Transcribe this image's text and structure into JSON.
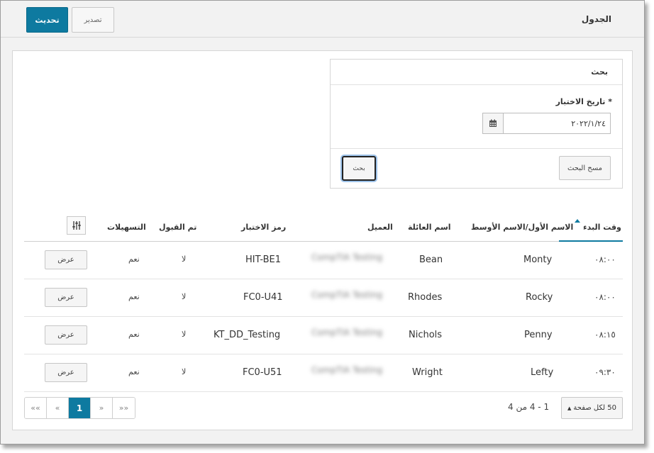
{
  "header": {
    "title": "الجدول",
    "refresh_label": "تحديث",
    "export_label": "تصدير"
  },
  "search": {
    "title": "بحث",
    "date_label": "تاريخ الاختبار *",
    "date_value": "٢٠٢٢/١/٢٤",
    "clear_label": "مسح البحث",
    "search_label": "بحث"
  },
  "table": {
    "columns": {
      "start_time": "وقت البدء",
      "first_middle": "الاسم الأول/الاسم الأوسط",
      "last_name": "اسم العائلة",
      "client": "العميل",
      "test_code": "رمز الاختبار",
      "accepted": "تم القبول",
      "accommodations": "التسهيلات"
    },
    "rows": [
      {
        "time": "٠٨:٠٠",
        "first": "Monty",
        "last": "Bean",
        "client": "CompTIA Testing",
        "code": "HIT-BE1",
        "accepted": "لا",
        "accommodations": "نعم",
        "view": "عرض"
      },
      {
        "time": "٠٨:٠٠",
        "first": "Rocky",
        "last": "Rhodes",
        "client": "CompTIA Testing",
        "code": "FC0-U41",
        "accepted": "لا",
        "accommodations": "نعم",
        "view": "عرض"
      },
      {
        "time": "٠٨:١٥",
        "first": "Penny",
        "last": "Nichols",
        "client": "CompTIA Testing",
        "code": "KT_DD_Testing",
        "accepted": "لا",
        "accommodations": "نعم",
        "view": "عرض"
      },
      {
        "time": "٠٩:٣٠",
        "first": "Lefty",
        "last": "Wright",
        "client": "CompTIA Testing",
        "code": "FC0-U51",
        "accepted": "لا",
        "accommodations": "نعم",
        "view": "عرض"
      }
    ]
  },
  "pagination": {
    "first": "««",
    "prev": "«",
    "current": "1",
    "next": "»",
    "last": "»»",
    "count_text": "1 - 4 من 4",
    "per_page_label": "50 لكل صفحة"
  },
  "colors": {
    "accent": "#0e7aa0"
  }
}
